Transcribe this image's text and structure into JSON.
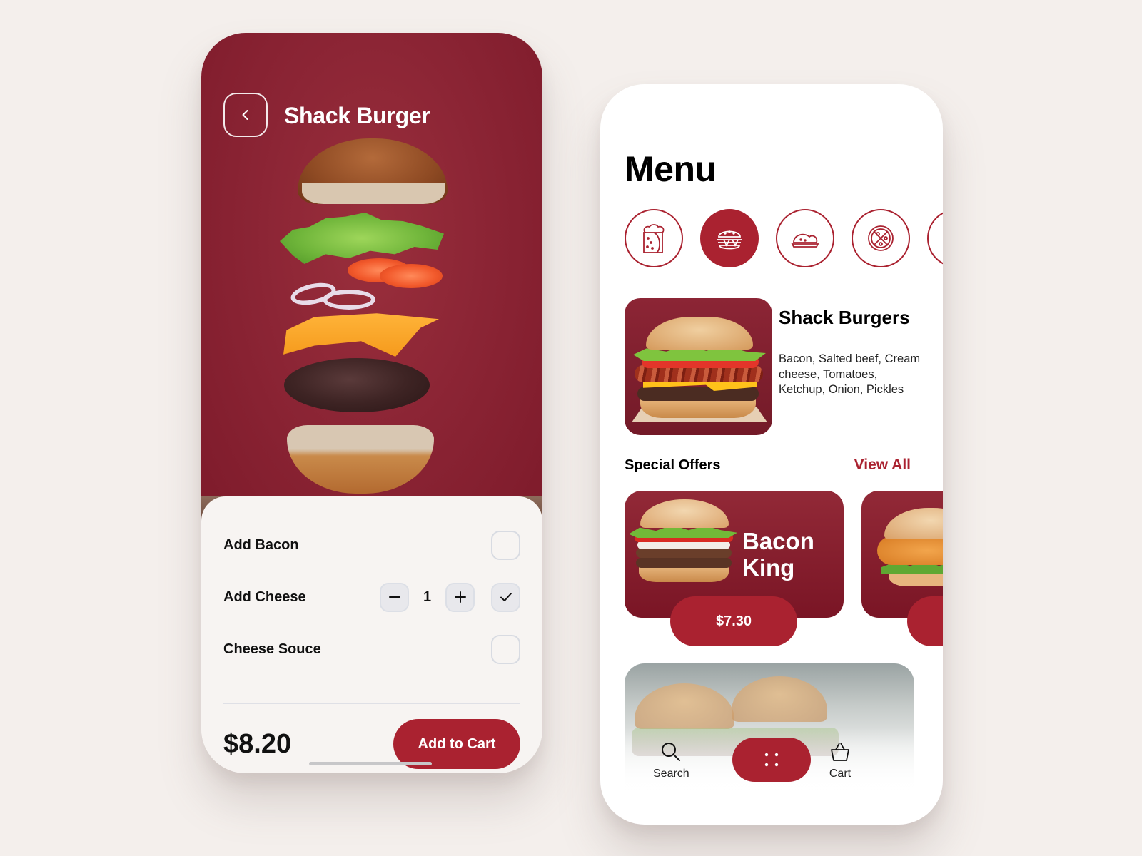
{
  "theme": {
    "accent": "#aa2230",
    "hero_bg": "#8c2535",
    "background": "#f4efec"
  },
  "detail_screen": {
    "title": "Shack Burger",
    "back_icon": "chevron-left-icon",
    "options": [
      {
        "label": "Add Bacon",
        "checked": false
      },
      {
        "label": "Add Cheese",
        "checked": true,
        "quantity": "1"
      },
      {
        "label": "Cheese Souce",
        "checked": false
      }
    ],
    "price": "$8.20",
    "add_to_cart_label": "Add to Cart"
  },
  "menu_screen": {
    "title": "Menu",
    "categories": [
      {
        "icon": "burrito-icon",
        "active": false
      },
      {
        "icon": "burger-icon",
        "active": true
      },
      {
        "icon": "taco-icon",
        "active": false
      },
      {
        "icon": "pizza-icon",
        "active": false
      },
      {
        "icon": "sandwich-icon",
        "active": false
      }
    ],
    "featured": {
      "name": "Shack Burgers",
      "description": "Bacon, Salted beef, Cream cheese, Tomatoes, Ketchup, Onion, Pickles"
    },
    "special_offers": {
      "title": "Special Offers",
      "view_all_label": "View All",
      "items": [
        {
          "name": "Bacon King",
          "price": "$7.30"
        },
        {
          "name": "",
          "price": ""
        }
      ]
    },
    "bottom_nav": {
      "search_label": "Search",
      "cart_label": "Cart",
      "home_icon": "grid-dots-icon"
    }
  }
}
